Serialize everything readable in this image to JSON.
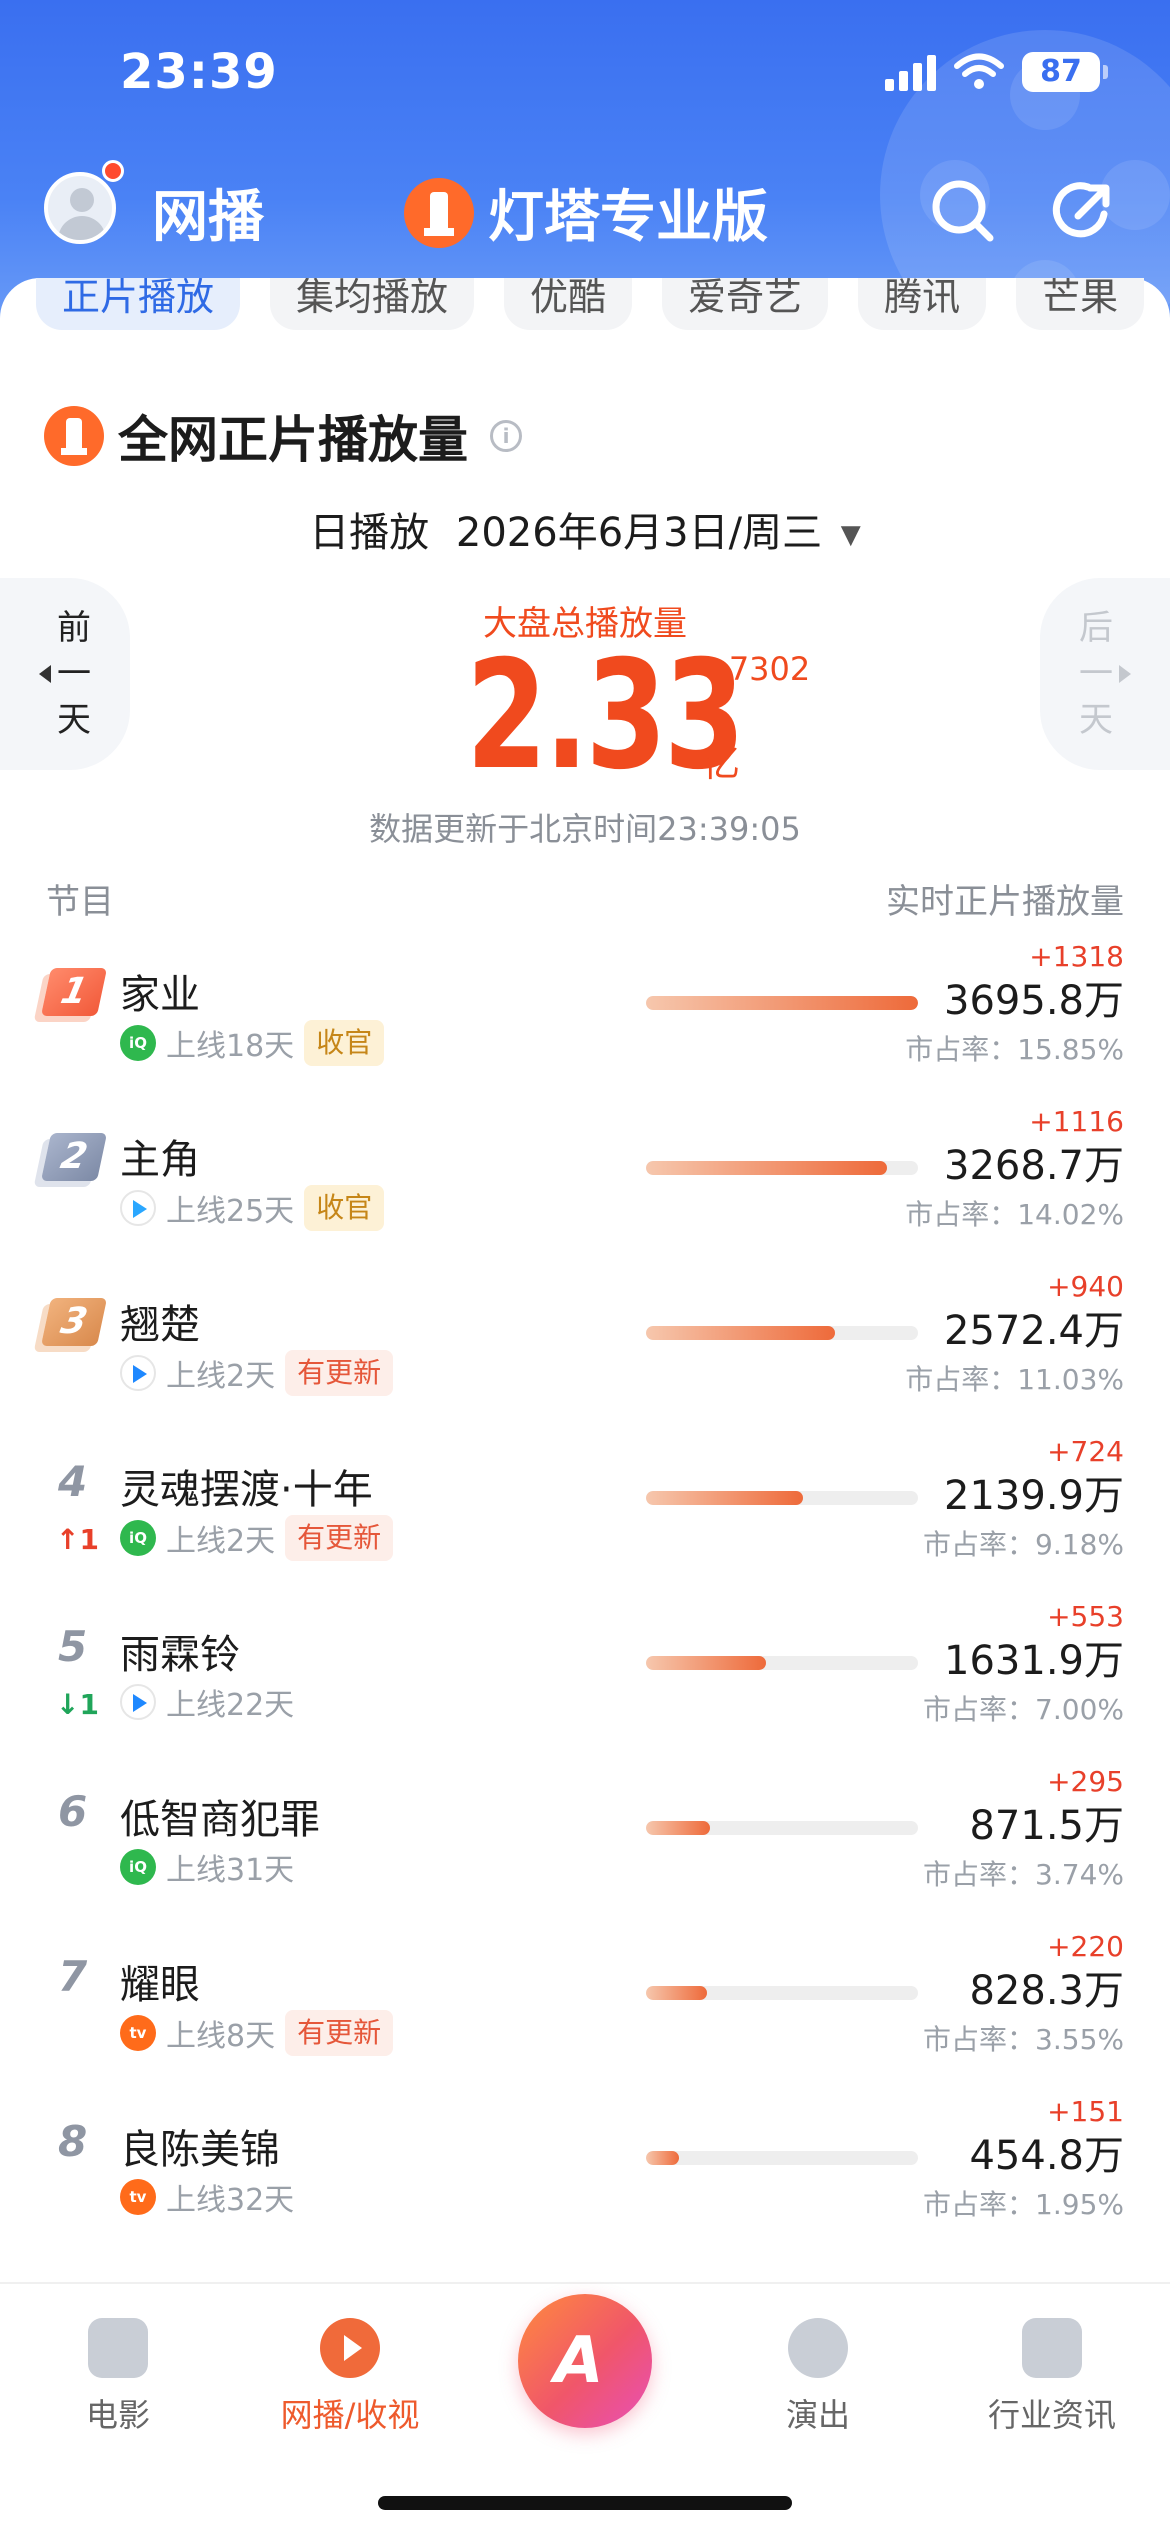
{
  "status": {
    "time": "23:39",
    "battery": "87"
  },
  "header": {
    "app_title": "网播",
    "brand": "灯塔专业版"
  },
  "tabs": [
    "正片播放",
    "集均播放",
    "优酷",
    "爱奇艺",
    "腾讯",
    "芒果"
  ],
  "section": {
    "title": "全网正片播放量"
  },
  "date": {
    "mode": "日播放",
    "value": "2026年6月3日/周三"
  },
  "nav_day": {
    "prev": [
      "前",
      "一",
      "天"
    ],
    "next": [
      "后",
      "一",
      "天"
    ]
  },
  "total": {
    "label": "大盘总播放量",
    "value": "2.33",
    "increment": "+7302",
    "unit": "亿",
    "updated": "数据更新于北京时间23:39:05"
  },
  "columns": {
    "left": "节目",
    "right": "实时正片播放量"
  },
  "share_prefix": "市占率：",
  "rows": [
    {
      "rank": "1",
      "change": "",
      "title": "家业",
      "platform": "iqiyi",
      "days": "上线18天",
      "tag": "收官",
      "tag_type": "gold",
      "increment": "+1318",
      "value": "3695.8万",
      "share": "15.85%",
      "bar": 1.0
    },
    {
      "rank": "2",
      "change": "",
      "title": "主角",
      "platform": "tencent",
      "days": "上线25天",
      "tag": "收官",
      "tag_type": "gold",
      "increment": "+1116",
      "value": "3268.7万",
      "share": "14.02%",
      "bar": 0.885
    },
    {
      "rank": "3",
      "change": "",
      "title": "翘楚",
      "platform": "youku",
      "days": "上线2天",
      "tag": "有更新",
      "tag_type": "new",
      "increment": "+940",
      "value": "2572.4万",
      "share": "11.03%",
      "bar": 0.696
    },
    {
      "rank": "4",
      "change": "↑1",
      "change_dir": "up",
      "title": "灵魂摆渡·十年",
      "platform": "iqiyi",
      "days": "上线2天",
      "tag": "有更新",
      "tag_type": "new",
      "increment": "+724",
      "value": "2139.9万",
      "share": "9.18%",
      "bar": 0.579
    },
    {
      "rank": "5",
      "change": "↓1",
      "change_dir": "down",
      "title": "雨霖铃",
      "platform": "youku",
      "days": "上线22天",
      "tag": "",
      "tag_type": "",
      "increment": "+553",
      "value": "1631.9万",
      "share": "7.00%",
      "bar": 0.442
    },
    {
      "rank": "6",
      "change": "",
      "title": "低智商犯罪",
      "platform": "iqiyi",
      "days": "上线31天",
      "tag": "",
      "tag_type": "",
      "increment": "+295",
      "value": "871.5万",
      "share": "3.74%",
      "bar": 0.236
    },
    {
      "rank": "7",
      "change": "",
      "title": "耀眼",
      "platform": "mango",
      "days": "上线8天",
      "tag": "有更新",
      "tag_type": "new",
      "increment": "+220",
      "value": "828.3万",
      "share": "3.55%",
      "bar": 0.224
    },
    {
      "rank": "8",
      "change": "",
      "title": "良陈美锦",
      "platform": "mango",
      "days": "上线32天",
      "tag": "",
      "tag_type": "",
      "increment": "+151",
      "value": "454.8万",
      "share": "1.95%",
      "bar": 0.123
    }
  ],
  "bottom_nav": [
    {
      "label": "电影",
      "icon": "film-icon",
      "active": false
    },
    {
      "label": "网播/收视",
      "icon": "play-icon",
      "active": true
    },
    {
      "label": "",
      "icon": "app-center-icon",
      "active": false
    },
    {
      "label": "演出",
      "icon": "microphone-icon",
      "active": false
    },
    {
      "label": "行业资讯",
      "icon": "news-icon",
      "active": false
    }
  ],
  "colors": {
    "accent": "#f04a1e",
    "header_blue": "#3a6ff0",
    "increase_red": "#e8402a",
    "decrease_green": "#20a55a"
  }
}
